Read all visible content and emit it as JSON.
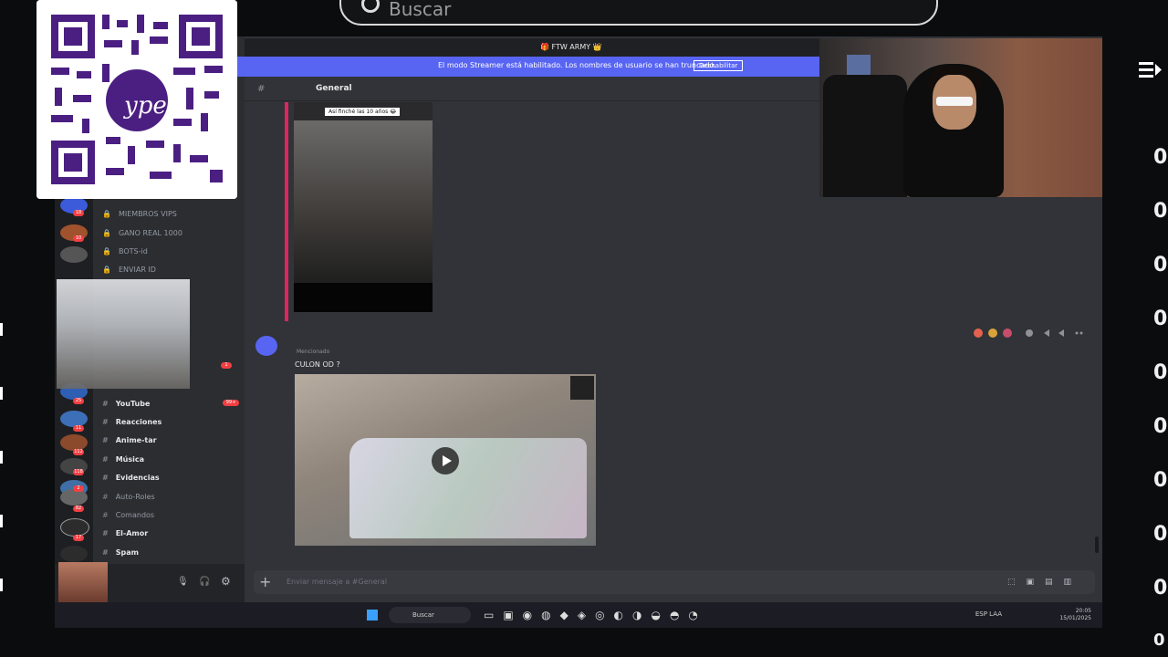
{
  "outer_search": {
    "placeholder": "Buscar"
  },
  "top_line": {
    "text": "🎁 FTW ARMY 👑"
  },
  "banner": {
    "message": "El modo Streamer está habilitado. Los nombres de usuario se han truncado.",
    "button": "Deshabilitar"
  },
  "channel_header": {
    "hash": "#",
    "name": "General"
  },
  "channels": [
    {
      "label": "MIEMBROS VIPS",
      "top": 0
    },
    {
      "label": "GANO REAL 1000",
      "top": 0
    },
    {
      "label": "BOTS-id",
      "top": 0
    },
    {
      "label": "ENVIAR ID",
      "top": 0
    }
  ],
  "channels_lower": [
    {
      "label": "YouTube"
    },
    {
      "label": "Reacciones"
    },
    {
      "label": "Anime-tar"
    },
    {
      "label": "Música"
    },
    {
      "label": "Evidencias"
    },
    {
      "label": "Auto-Roles"
    },
    {
      "label": "Comandos"
    },
    {
      "label": "El-Amor"
    },
    {
      "label": "Spam"
    }
  ],
  "channel_badges": {
    "youtube": "99+",
    "general": "1"
  },
  "server_badges": [
    "18",
    "10",
    "25",
    "11",
    "112",
    "118",
    "2",
    "82",
    "17"
  ],
  "video1": {
    "tag": "Así finché las 10 años 😂"
  },
  "message2": {
    "sub": "Mencionado",
    "text": "CULON OD ?"
  },
  "composer": {
    "placeholder": "Enviar mensaje a #General",
    "plus": "+"
  },
  "taskbar": {
    "search": "Buscar",
    "tray_lang": "ESP LAA",
    "time": "20:05",
    "date": "15/01/2025"
  },
  "user_panel": {
    "count": "x117"
  },
  "right_counters": [
    "0",
    "0",
    "0",
    "0",
    "0",
    "0",
    "0",
    "0",
    "0",
    "0",
    "0"
  ],
  "colors": {
    "accent": "#5865f2",
    "discord_bg": "#313338",
    "badge_red": "#f23f43"
  },
  "icons": [
    "search-icon",
    "menu-icon",
    "discord-icon",
    "play-icon",
    "mic-icon",
    "headphones-icon",
    "gear-icon",
    "plus-icon",
    "gift-icon",
    "windows-icon"
  ]
}
